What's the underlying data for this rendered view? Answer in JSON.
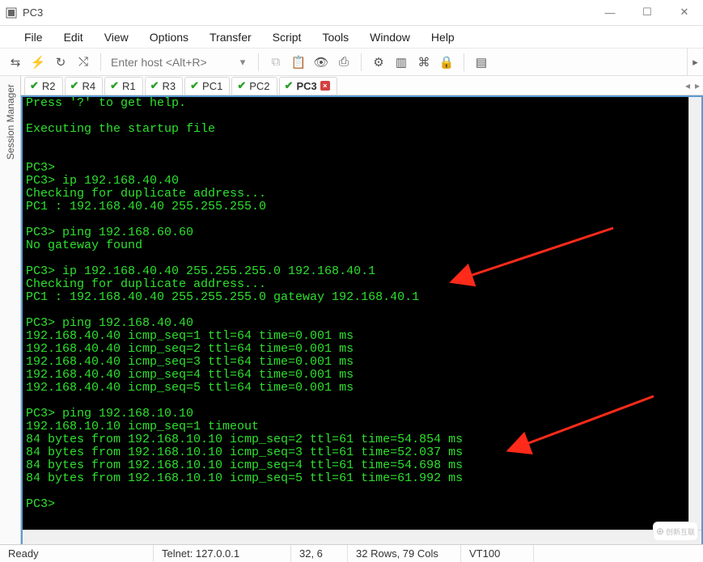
{
  "window": {
    "title": "PC3",
    "icon_name": "app-icon"
  },
  "window_controls": {
    "minimize": "—",
    "maximize": "☐",
    "close": "✕"
  },
  "menubar": [
    "File",
    "Edit",
    "View",
    "Options",
    "Transfer",
    "Script",
    "Tools",
    "Window",
    "Help"
  ],
  "toolbar": {
    "host_placeholder": "Enter host <Alt+R>",
    "icons": [
      "connect-icon",
      "quick-connect-icon",
      "reconnect-icon",
      "disconnect-icon",
      "sep",
      "host-field",
      "dropdown",
      "sep",
      "copy-icon",
      "paste-icon",
      "find-icon",
      "print-icon",
      "sep",
      "settings-icon",
      "device-icon",
      "key-icon",
      "lock-icon",
      "sep",
      "ftp-icon"
    ]
  },
  "session_manager": {
    "label": "Session Manager"
  },
  "tabs": [
    {
      "label": "R2",
      "active": false
    },
    {
      "label": "R4",
      "active": false
    },
    {
      "label": "R1",
      "active": false
    },
    {
      "label": "R3",
      "active": false
    },
    {
      "label": "PC1",
      "active": false
    },
    {
      "label": "PC2",
      "active": false
    },
    {
      "label": "PC3",
      "active": true
    }
  ],
  "terminal_lines": [
    "Press '?' to get help.",
    "",
    "Executing the startup file",
    "",
    "",
    "PC3>",
    "PC3> ip 192.168.40.40",
    "Checking for duplicate address...",
    "PC1 : 192.168.40.40 255.255.255.0",
    "",
    "PC3> ping 192.168.60.60",
    "No gateway found",
    "",
    "PC3> ip 192.168.40.40 255.255.255.0 192.168.40.1",
    "Checking for duplicate address...",
    "PC1 : 192.168.40.40 255.255.255.0 gateway 192.168.40.1",
    "",
    "PC3> ping 192.168.40.40",
    "192.168.40.40 icmp_seq=1 ttl=64 time=0.001 ms",
    "192.168.40.40 icmp_seq=2 ttl=64 time=0.001 ms",
    "192.168.40.40 icmp_seq=3 ttl=64 time=0.001 ms",
    "192.168.40.40 icmp_seq=4 ttl=64 time=0.001 ms",
    "192.168.40.40 icmp_seq=5 ttl=64 time=0.001 ms",
    "",
    "PC3> ping 192.168.10.10",
    "192.168.10.10 icmp_seq=1 timeout",
    "84 bytes from 192.168.10.10 icmp_seq=2 ttl=61 time=54.854 ms",
    "84 bytes from 192.168.10.10 icmp_seq=3 ttl=61 time=52.037 ms",
    "84 bytes from 192.168.10.10 icmp_seq=4 ttl=61 time=54.698 ms",
    "84 bytes from 192.168.10.10 icmp_seq=5 ttl=61 time=61.992 ms",
    "",
    "PC3>"
  ],
  "status": {
    "state": "Ready",
    "conn": "Telnet: 127.0.0.1",
    "pos": "32,  6",
    "size": "32 Rows, 79 Cols",
    "emul": "VT100"
  },
  "watermark": "创新互联"
}
